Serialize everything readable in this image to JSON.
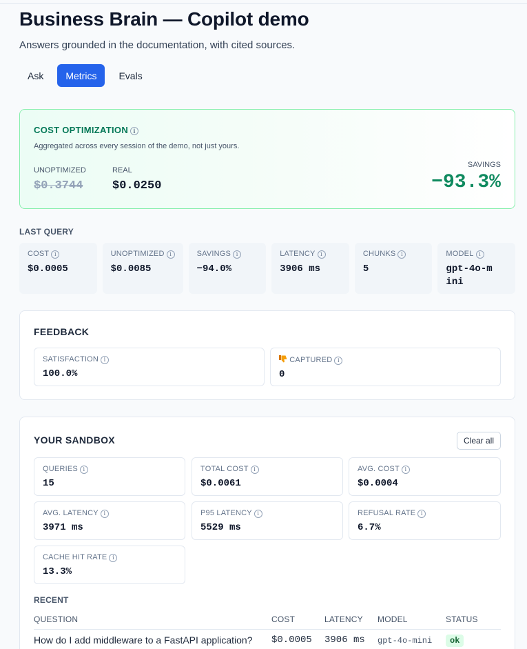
{
  "header": {
    "title": "Business Brain — Copilot demo",
    "subtitle": "Answers grounded in the documentation, with cited sources."
  },
  "tabs": [
    {
      "label": "Ask",
      "active": false
    },
    {
      "label": "Metrics",
      "active": true
    },
    {
      "label": "Evals",
      "active": false
    }
  ],
  "cost_optimization": {
    "title": "COST OPTIMIZATION",
    "description": "Aggregated across every session of the demo, not just yours.",
    "unoptimized_label": "UNOPTIMIZED",
    "unoptimized_value": "$0.3744",
    "real_label": "REAL",
    "real_value": "$0.0250",
    "savings_label": "SAVINGS",
    "savings_value": "−93.3%"
  },
  "last_query": {
    "title": "LAST QUERY",
    "metrics": [
      {
        "label": "COST",
        "value": "$0.0005"
      },
      {
        "label": "UNOPTIMIZED",
        "value": "$0.0085"
      },
      {
        "label": "SAVINGS",
        "value": "−94.0%"
      },
      {
        "label": "LATENCY",
        "value": "3906 ms"
      },
      {
        "label": "CHUNKS",
        "value": "5"
      },
      {
        "label": "MODEL",
        "value": "gpt-4o-mini"
      }
    ]
  },
  "feedback": {
    "title": "FEEDBACK",
    "satisfaction_label": "SATISFACTION",
    "satisfaction_value": "100.0%",
    "captured_label": "CAPTURED",
    "captured_value": "0"
  },
  "sandbox": {
    "title": "YOUR SANDBOX",
    "clear_label": "Clear all",
    "metrics": [
      {
        "label": "QUERIES",
        "value": "15"
      },
      {
        "label": "TOTAL COST",
        "value": "$0.0061"
      },
      {
        "label": "AVG. COST",
        "value": "$0.0004"
      },
      {
        "label": "AVG. LATENCY",
        "value": "3971 ms"
      },
      {
        "label": "P95 LATENCY",
        "value": "5529 ms"
      },
      {
        "label": "REFUSAL RATE",
        "value": "6.7%"
      },
      {
        "label": "CACHE HIT RATE",
        "value": "13.3%"
      }
    ],
    "recent_title": "RECENT",
    "columns": [
      "QUESTION",
      "COST",
      "LATENCY",
      "MODEL",
      "STATUS"
    ],
    "rows": [
      {
        "question": "How do I add middleware to a FastAPI application?",
        "cost": "$0.0005",
        "latency": "3906 ms",
        "model": "gpt-4o-mini",
        "status": "ok"
      }
    ]
  },
  "icons": {
    "info": "info-icon",
    "thumbs_down": "thumbs-down-icon"
  },
  "colors": {
    "accent": "#2563eb",
    "savings": "#0f8a5f",
    "success_border": "#86efac"
  }
}
